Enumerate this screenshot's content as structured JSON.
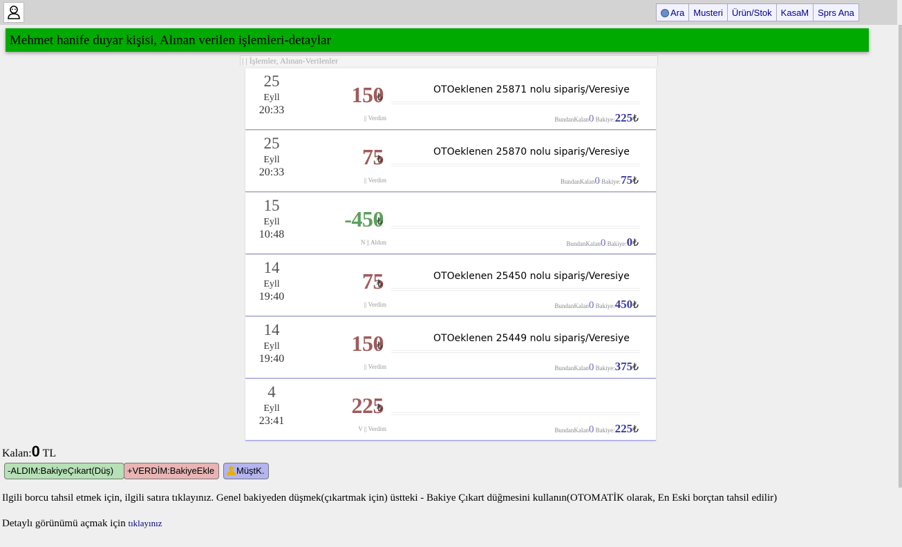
{
  "nav": {
    "items": [
      {
        "label": "Ara",
        "icon": "globe-icon"
      },
      {
        "label": "Musteri"
      },
      {
        "label": "Ürün/Stok"
      },
      {
        "label": "KasaM"
      },
      {
        "label": "Sprs Ana"
      }
    ]
  },
  "header": {
    "title": "Mehmet hanife duyar kişisi, Alınan verilen işlemleri-detaylar"
  },
  "list": {
    "heading": "| | İşlemler, Alınan-Verilenler",
    "currency": "₺",
    "balance_label": "BundanKalan",
    "bakiye_label": "Bakiye:",
    "rows": [
      {
        "day": "25",
        "month": "Eyll",
        "time": "20:33",
        "amount": "150",
        "meta": "||  Verdim",
        "title": "OTOeklenen 25871 nolu sipariş/Veresiye",
        "kalan": "0",
        "bakiye": "225"
      },
      {
        "day": "25",
        "month": "Eyll",
        "time": "20:33",
        "amount": "75",
        "meta": "||  Verdim",
        "title": "OTOeklenen 25870 nolu sipariş/Veresiye",
        "kalan": "0",
        "bakiye": "75"
      },
      {
        "day": "15",
        "month": "Eyll",
        "time": "10:48",
        "amount": "-450",
        "meta": "N ||  Aldım",
        "title": "",
        "kalan": "0",
        "bakiye": "0"
      },
      {
        "day": "14",
        "month": "Eyll",
        "time": "19:40",
        "amount": "75",
        "meta": "||  Verdim",
        "title": "OTOeklenen 25450 nolu sipariş/Veresiye",
        "kalan": "0",
        "bakiye": "450"
      },
      {
        "day": "14",
        "month": "Eyll",
        "time": "19:40",
        "amount": "150",
        "meta": "||  Verdim",
        "title": "OTOeklenen 25449 nolu sipariş/Veresiye",
        "kalan": "0",
        "bakiye": "375"
      },
      {
        "day": "4",
        "month": "Eyll",
        "time": "23:41",
        "amount": "225",
        "meta": "V ||  Verdim",
        "title": "",
        "kalan": "0",
        "bakiye": "225"
      }
    ]
  },
  "summary": {
    "label": "Kalan:",
    "value": "0",
    "unit": "TL"
  },
  "actions": {
    "aldim": "-ALDIM:BakiyeÇıkart(Düş)",
    "verdim": "+VERDİM:BakiyeEkle",
    "musteri": "MüştK."
  },
  "info": {
    "text": "Ilgili borcu tahsil etmek için, ilgili satıra tıklayınız. Genel bakiyeden düşmek(çıkartmak için) üstteki - Bakiye Çıkart düğmesini kullanın(OTOMATİK olarak, En Eski borçtan tahsil edilir)",
    "detail_prefix": "Detaylı görünümü açmak için",
    "detail_link": "tıklayınız"
  },
  "colors": {
    "header_green": "#00aa00",
    "amount_positive": "#a05a5a",
    "amount_negative": "#5aa05a",
    "balance_blue": "#3a3aa8"
  }
}
